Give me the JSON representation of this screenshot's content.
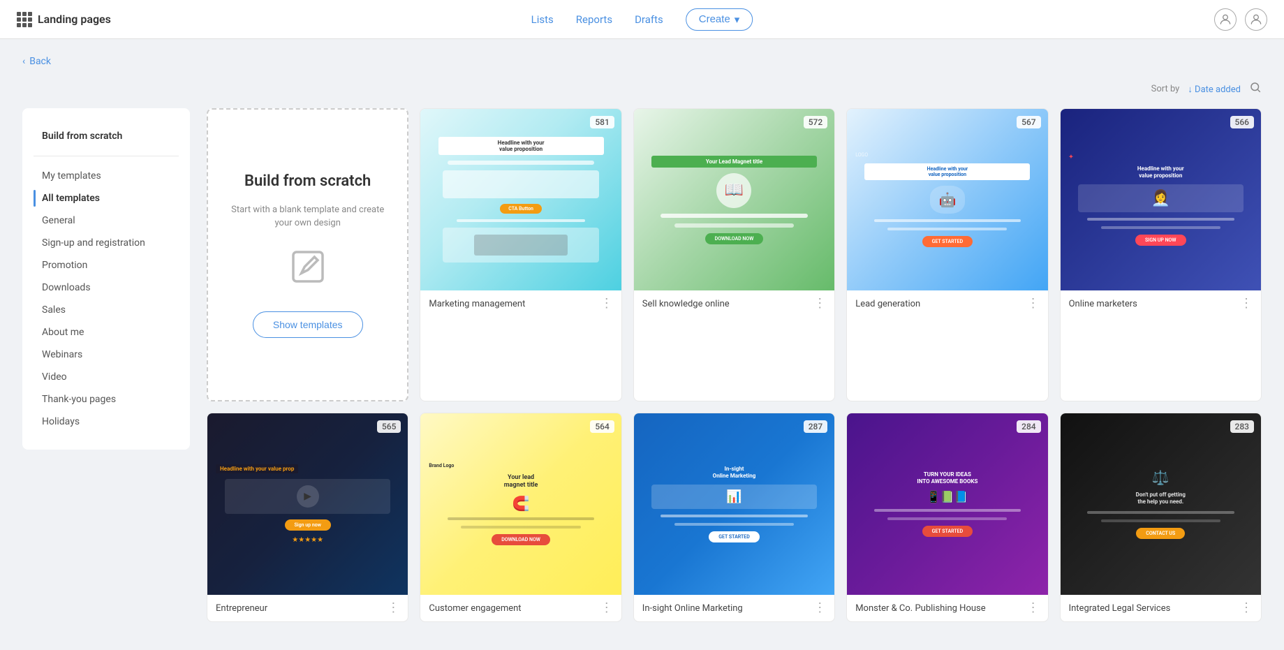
{
  "app": {
    "title": "Landing pages"
  },
  "nav": {
    "lists_label": "Lists",
    "reports_label": "Reports",
    "drafts_label": "Drafts",
    "create_label": "Create",
    "back_label": "Back"
  },
  "sortbar": {
    "sort_by_label": "Sort by",
    "sort_value": "↓ Date added",
    "search_tooltip": "Search"
  },
  "sidebar": {
    "build_from_scratch": "Build from scratch",
    "my_templates": "My templates",
    "all_templates": "All templates",
    "general": "General",
    "signup_registration": "Sign-up and registration",
    "promotion": "Promotion",
    "downloads": "Downloads",
    "sales": "Sales",
    "about_me": "About me",
    "webinars": "Webinars",
    "video": "Video",
    "thank_you_pages": "Thank-you pages",
    "holidays": "Holidays"
  },
  "scratch_card": {
    "title": "Build from scratch",
    "subtitle": "Start with a blank template and create your own design",
    "button": "Show templates"
  },
  "templates": [
    {
      "name": "Marketing management",
      "count": "581",
      "color_class": "preview-marketing"
    },
    {
      "name": "Sell knowledge online",
      "count": "572",
      "color_class": "preview-sell"
    },
    {
      "name": "Lead generation",
      "count": "567",
      "color_class": "preview-lead"
    },
    {
      "name": "Online marketers",
      "count": "566",
      "color_class": "preview-online"
    },
    {
      "name": "Entrepreneur",
      "count": "565",
      "color_class": "preview-entrepreneur"
    },
    {
      "name": "Customer engagement",
      "count": "564",
      "color_class": "preview-customer"
    },
    {
      "name": "In-sight Online Marketing",
      "count": "287",
      "color_class": "preview-insight"
    },
    {
      "name": "Monster & Co. Publishing House",
      "count": "284",
      "color_class": "preview-monster"
    },
    {
      "name": "Integrated Legal Services",
      "count": "283",
      "color_class": "preview-legal"
    }
  ]
}
